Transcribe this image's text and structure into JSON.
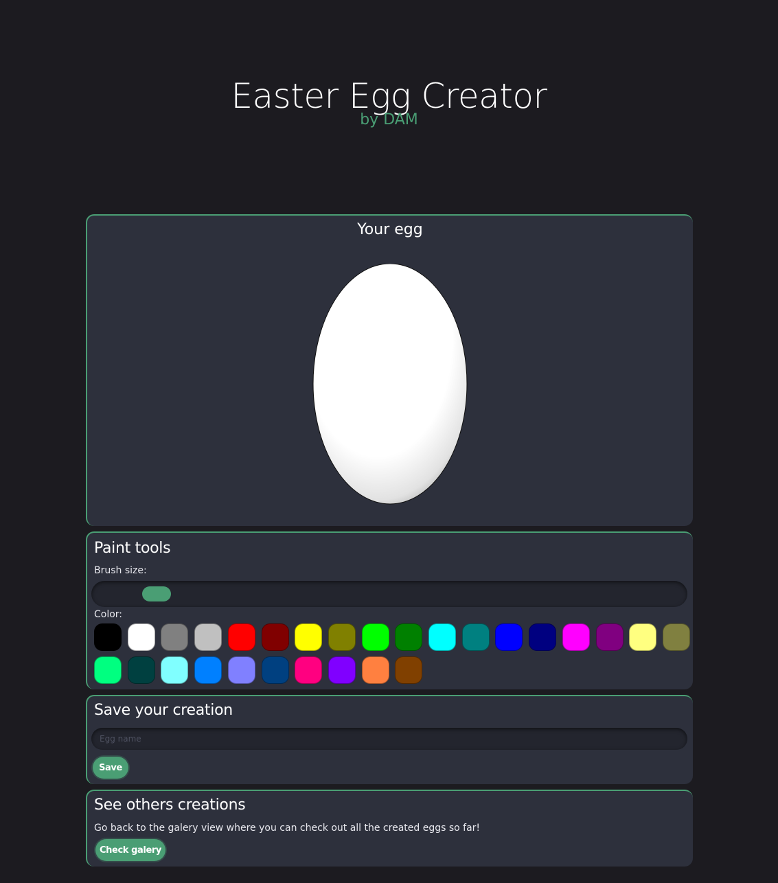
{
  "header": {
    "title": "Easter Egg Creator",
    "subtitle": "by DAM"
  },
  "egg_panel": {
    "title": "Your egg"
  },
  "paint_tools": {
    "title": "Paint tools",
    "brush_size_label": "Brush size:",
    "brush_size_level": 0.09,
    "color_label": "Color:",
    "colors": [
      "#000000",
      "#ffffff",
      "#808080",
      "#c0c0c0",
      "#ff0000",
      "#800000",
      "#ffff00",
      "#808000",
      "#00ff00",
      "#008000",
      "#00ffff",
      "#008080",
      "#0000ff",
      "#000080",
      "#ff00ff",
      "#800080",
      "#ffff80",
      "#808040",
      "#00ff80",
      "#004040",
      "#80ffff",
      "#0080ff",
      "#8080ff",
      "#004080",
      "#ff0080",
      "#8000ff",
      "#ff8040",
      "#804000"
    ]
  },
  "save_panel": {
    "title": "Save your creation",
    "input_placeholder": "Egg name",
    "input_value": "",
    "save_label": "Save"
  },
  "gallery_panel": {
    "title": "See others creations",
    "description": "Go back to the galery view where you can check out all the created eggs so far!",
    "button_label": "Check galery"
  },
  "colors": {
    "accent": "#4a9e74",
    "background": "#1c1b20",
    "panel": "#2d303c"
  }
}
